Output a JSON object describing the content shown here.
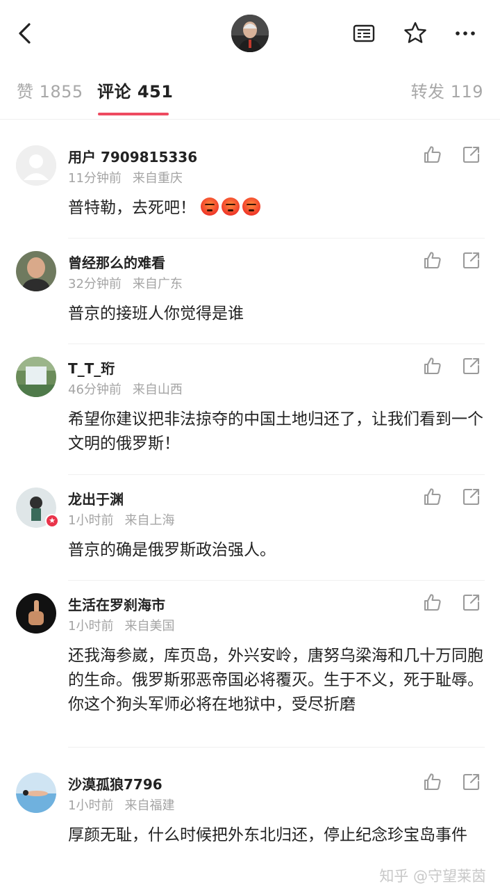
{
  "header": {
    "back_icon": "chevron-left-icon",
    "avatar_icon": "user-avatar",
    "actions": [
      {
        "name": "reader-mode-icon"
      },
      {
        "name": "star-icon"
      },
      {
        "name": "more-icon"
      }
    ]
  },
  "tabs": {
    "likes": "赞 1855",
    "comments": "评论 451",
    "reposts": "转发 119",
    "active_color": "#ee4a60"
  },
  "comments": [
    {
      "user": "用户 7909815336",
      "time": "11分钟前",
      "location": "来自重庆",
      "text": "普特勒，去死吧！",
      "emoji_count": 3
    },
    {
      "user": "曾经那么的难看",
      "time": "32分钟前",
      "location": "来自广东",
      "text": "普京的接班人你觉得是谁"
    },
    {
      "user": "T_T_珩",
      "time": "46分钟前",
      "location": "来自山西",
      "text": "希望你建议把非法掠夺的中国土地归还了，让我们看到一个文明的俄罗斯！"
    },
    {
      "user": "龙出于渊",
      "time": "1小时前",
      "location": "来自上海",
      "text": "普京的确是俄罗斯政治强人。"
    },
    {
      "user": "生活在罗刹海市",
      "time": "1小时前",
      "location": "来自美国",
      "text": "还我海参崴，库页岛，外兴安岭，唐努乌梁海和几十万同胞的生命。俄罗斯邪恶帝国必将覆灭。生于不义，死于耻辱。你这个狗头军师必将在地狱中，受尽折磨"
    },
    {
      "user": "沙漠孤狼7796",
      "time": "1小时前",
      "location": "来自福建",
      "text": "厚颜无耻，什么时候把外东北归还，停止纪念珍宝岛事件"
    }
  ],
  "watermark": "知乎 @守望莱茵"
}
